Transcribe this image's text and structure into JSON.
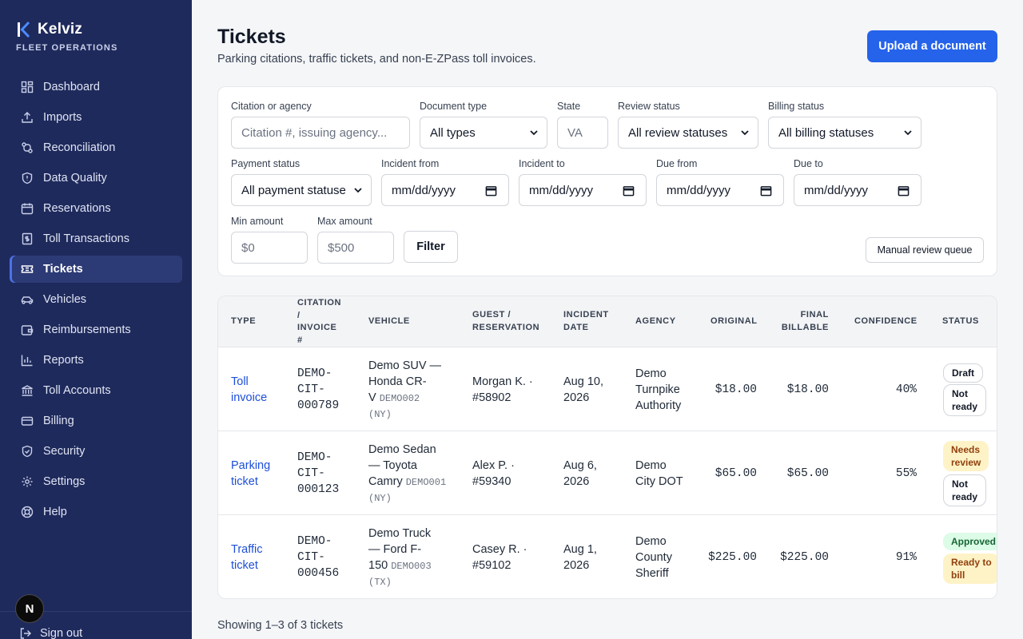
{
  "app": {
    "name": "Kelviz",
    "subtitle": "FLEET OPERATIONS",
    "user_initial": "N",
    "sign_out": "Sign out"
  },
  "sidebar": {
    "items": [
      {
        "label": "Dashboard",
        "icon": "dashboard-icon"
      },
      {
        "label": "Imports",
        "icon": "upload-icon"
      },
      {
        "label": "Reconciliation",
        "icon": "reconcile-icon"
      },
      {
        "label": "Data Quality",
        "icon": "shield-icon"
      },
      {
        "label": "Reservations",
        "icon": "calendar-icon"
      },
      {
        "label": "Toll Transactions",
        "icon": "receipt-icon"
      },
      {
        "label": "Tickets",
        "icon": "ticket-icon",
        "active": true
      },
      {
        "label": "Vehicles",
        "icon": "car-icon"
      },
      {
        "label": "Reimbursements",
        "icon": "wallet-icon"
      },
      {
        "label": "Reports",
        "icon": "bar-chart-icon"
      },
      {
        "label": "Toll Accounts",
        "icon": "bank-icon"
      },
      {
        "label": "Billing",
        "icon": "credit-card-icon"
      },
      {
        "label": "Security",
        "icon": "shield-check-icon"
      },
      {
        "label": "Settings",
        "icon": "gear-icon"
      },
      {
        "label": "Help",
        "icon": "lifebuoy-icon"
      }
    ]
  },
  "header": {
    "title": "Tickets",
    "subtitle": "Parking citations, traffic tickets, and non-E-ZPass toll invoices.",
    "upload_label": "Upload a document"
  },
  "filters": {
    "citation": {
      "label": "Citation or agency",
      "placeholder": "Citation #, issuing agency..."
    },
    "doc_type": {
      "label": "Document type",
      "value": "All types"
    },
    "state": {
      "label": "State",
      "placeholder": "VA"
    },
    "review_status": {
      "label": "Review status",
      "value": "All review statuses"
    },
    "billing_status": {
      "label": "Billing status",
      "value": "All billing statuses"
    },
    "payment_status": {
      "label": "Payment status",
      "value": "All payment statuse"
    },
    "incident_from": {
      "label": "Incident from",
      "placeholder": "mm/dd/yyyy"
    },
    "incident_to": {
      "label": "Incident to",
      "placeholder": "mm/dd/yyyy"
    },
    "due_from": {
      "label": "Due from",
      "placeholder": "mm/dd/yyyy"
    },
    "due_to": {
      "label": "Due to",
      "placeholder": "mm/dd/yyyy"
    },
    "min_amount": {
      "label": "Min amount",
      "placeholder": "$0"
    },
    "max_amount": {
      "label": "Max amount",
      "placeholder": "$500"
    },
    "filter_label": "Filter",
    "manual_review_label": "Manual review queue"
  },
  "table": {
    "headers": {
      "type": "TYPE",
      "citation_l1": "CITATION",
      "citation_l2": "/",
      "citation_l3": "INVOICE",
      "citation_l4": "#",
      "vehicle": "VEHICLE",
      "guest_l1": "GUEST /",
      "guest_l2": "RESERVATION",
      "incident_l1": "INCIDENT",
      "incident_l2": "DATE",
      "agency": "AGENCY",
      "original": "ORIGINAL",
      "final_l1": "FINAL",
      "final_l2": "BILLABLE",
      "confidence": "CONFIDENCE",
      "status": "STATUS"
    },
    "rows": [
      {
        "type_l1": "Toll",
        "type_l2": "invoice",
        "cit_l1": "DEMO-",
        "cit_l2": "CIT-",
        "cit_l3": "000789",
        "veh_l1": "Demo SUV —",
        "veh_l2": "Honda CR-",
        "veh_l3": "V",
        "plate": "DEMO002",
        "plate_state": "(NY)",
        "guest_l1": "Morgan K. ·",
        "guest_l2": "#58902",
        "date_l1": "Aug 10,",
        "date_l2": "2026",
        "agency_l1": "Demo",
        "agency_l2": "Turnpike",
        "agency_l3": "Authority",
        "original": "$18.00",
        "final": "$18.00",
        "confidence": "40%",
        "status1": "Draft",
        "status2_l1": "Not",
        "status2_l2": "ready"
      },
      {
        "type_l1": "Parking",
        "type_l2": "ticket",
        "cit_l1": "DEMO-",
        "cit_l2": "CIT-",
        "cit_l3": "000123",
        "veh_l1": "Demo Sedan",
        "veh_l2": "— Toyota",
        "veh_l3": "Camry",
        "plate": "DEMO001",
        "plate_state": "(NY)",
        "guest_l1": "Alex P. ·",
        "guest_l2": "#59340",
        "date_l1": "Aug 6,",
        "date_l2": "2026",
        "agency_l1": "Demo",
        "agency_l2": "City DOT",
        "agency_l3": "",
        "original": "$65.00",
        "final": "$65.00",
        "confidence": "55%",
        "status1_l1": "Needs",
        "status1_l2": "review",
        "status2_l1": "Not",
        "status2_l2": "ready"
      },
      {
        "type_l1": "Traffic",
        "type_l2": "ticket",
        "cit_l1": "DEMO-",
        "cit_l2": "CIT-",
        "cit_l3": "000456",
        "veh_l1": "Demo Truck",
        "veh_l2": "— Ford F-",
        "veh_l3": "150",
        "plate": "DEMO003",
        "plate_state": "(TX)",
        "guest_l1": "Casey R. ·",
        "guest_l2": "#59102",
        "date_l1": "Aug 1,",
        "date_l2": "2026",
        "agency_l1": "Demo",
        "agency_l2": "County",
        "agency_l3": "Sheriff",
        "original": "$225.00",
        "final": "$225.00",
        "confidence": "91%",
        "status1": "Approved",
        "status2_l1": "Ready to",
        "status2_l2": "bill"
      }
    ]
  },
  "footer": {
    "showing": "Showing 1–3 of 3 tickets"
  },
  "colors": {
    "sidebar_bg": "#1f2a5c",
    "accent": "#2563eb",
    "link": "#1d4ed8",
    "warn_bg": "#fef3c7",
    "ok_bg": "#dcfce7"
  }
}
